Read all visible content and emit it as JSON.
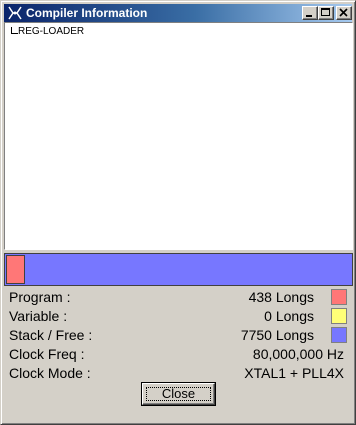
{
  "window": {
    "title": "Compiler Information",
    "icon": "propeller-app-icon"
  },
  "titlebar_buttons": {
    "minimize_icon": "minimize-icon",
    "maximize_icon": "maximize-icon",
    "close_icon": "close-icon"
  },
  "tree": {
    "items": [
      "REG-LOADER"
    ]
  },
  "memory_map": {
    "program_fraction": 0.054,
    "colors": {
      "program": "#ff7777",
      "variable": "#ffff77",
      "stack_free": "#7777ff"
    }
  },
  "info": {
    "program": {
      "label": "Program :",
      "value": "438 Longs"
    },
    "variable": {
      "label": "Variable :",
      "value": "0 Longs"
    },
    "stack_free": {
      "label": "Stack / Free :",
      "value": "7750 Longs"
    },
    "clock_freq": {
      "label": "Clock Freq :",
      "value": "80,000,000 Hz"
    },
    "clock_mode": {
      "label": "Clock Mode :",
      "value": "XTAL1 + PLL4X"
    }
  },
  "buttons": {
    "close_label": "Close"
  }
}
